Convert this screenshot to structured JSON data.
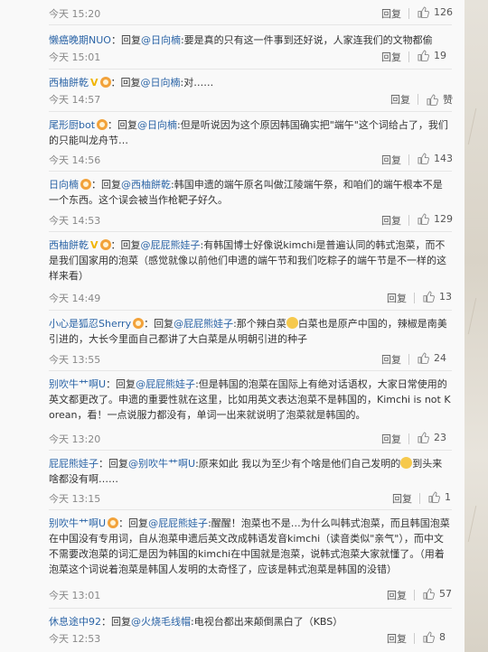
{
  "comments": [
    {
      "time": "今天 15:20",
      "reply": "回复",
      "likes": "126"
    },
    {
      "user": "懒癌晚期NUO",
      "mid": "：回复",
      "at": "@日向楠",
      "text": ":要是真的只有这一件事到还好说，人家连我们的文物都偷",
      "time": "今天 15:01",
      "reply": "回复",
      "likes": "19"
    },
    {
      "user": "西柚餅乾",
      "mid": "：回复",
      "at": "@日向楠",
      "text": ":对……",
      "time": "今天 14:57",
      "reply": "回复",
      "likes": "赞"
    },
    {
      "user": "尾形厨bot",
      "mid": "：回复",
      "at": "@日向楠",
      "text": ":但是听说因为这个原因韩国确实把\"端午\"这个词给占了，我们的只能叫龙舟节…",
      "time": "今天 14:56",
      "reply": "回复",
      "likes": "143"
    },
    {
      "user": "日向楠",
      "mid": "：回复",
      "at": "@西柚餅乾",
      "text": ":韩国申遗的端午原名叫做江陵端午祭，和咱们的端午根本不是一个东西。这个误会被当作枪靶子好久。",
      "time": "今天 14:53",
      "reply": "回复",
      "likes": "129"
    },
    {
      "user": "西柚餅乾",
      "mid": "：回复",
      "at": "@屁屁熊娃子",
      "text": ":有韩国博士好像说kimchi是普遍认同的韩式泡菜，而不是我们国家用的泡菜（感觉就像以前他们申遗的端午节和我们吃粽子的端午节是不一样的这样来看）",
      "time": "今天 14:49",
      "reply": "回复",
      "likes": "13"
    },
    {
      "user": "小心是狐忍Sherry",
      "mid": "：回复",
      "at": "@屁屁熊娃子",
      "text": ":那个辣白菜",
      "text2": "白菜也是原产中国的，辣椒是南美引进的，大长今里面自己都讲了大白菜是从明朝引进的种子",
      "time": "今天 13:55",
      "reply": "回复",
      "likes": "24"
    },
    {
      "user": "别吹牛艹啊U",
      "mid": "：回复",
      "at": "@屁屁熊娃子",
      "text": ":但是韩国的泡菜在国际上有绝对话语权，大家日常使用的英文都更改了。申遗的重要性就在这里，比如用英文表达泡菜不是韩国的，Kimchi is not Korean，看！一点说服力都没有，单词一出来就说明了泡菜就是韩国的。",
      "time": "今天 13:20",
      "reply": "回复",
      "likes": "23"
    },
    {
      "user": "屁屁熊娃子",
      "mid": "：回复",
      "at": "@别吹牛艹啊U",
      "text": ":原来如此 我以为至少有个啥是他们自己发明的",
      "text2": "到头来啥都没有啊……",
      "time": "今天 13:15",
      "reply": "回复",
      "likes": "1"
    },
    {
      "user": "别吹牛艹啊U",
      "mid": "：回复",
      "at": "@屁屁熊娃子",
      "text": ":醒醒！泡菜也不是…为什么叫韩式泡菜，而且韩国泡菜在中国没有专用词，自从泡菜申遗后英文改成韩语发音kimchi（读音类似\"亲气\"），而中文不需要改泡菜的词汇是因为韩国的kimchi在中国就是泡菜，说韩式泡菜大家就懂了。（用着泡菜这个词说着泡菜是韩国人发明的太奇怪了，应该是韩式泡菜是韩国的没错）",
      "time": "今天 13:01",
      "reply": "回复",
      "likes": "57"
    },
    {
      "user": "休息途中92",
      "mid": "：回复",
      "at": "@火烧毛线帽",
      "text": ":电视台都出来颠倒黑白了（KBS）",
      "time": "今天 12:53",
      "reply": "回复",
      "likes": "8"
    }
  ]
}
